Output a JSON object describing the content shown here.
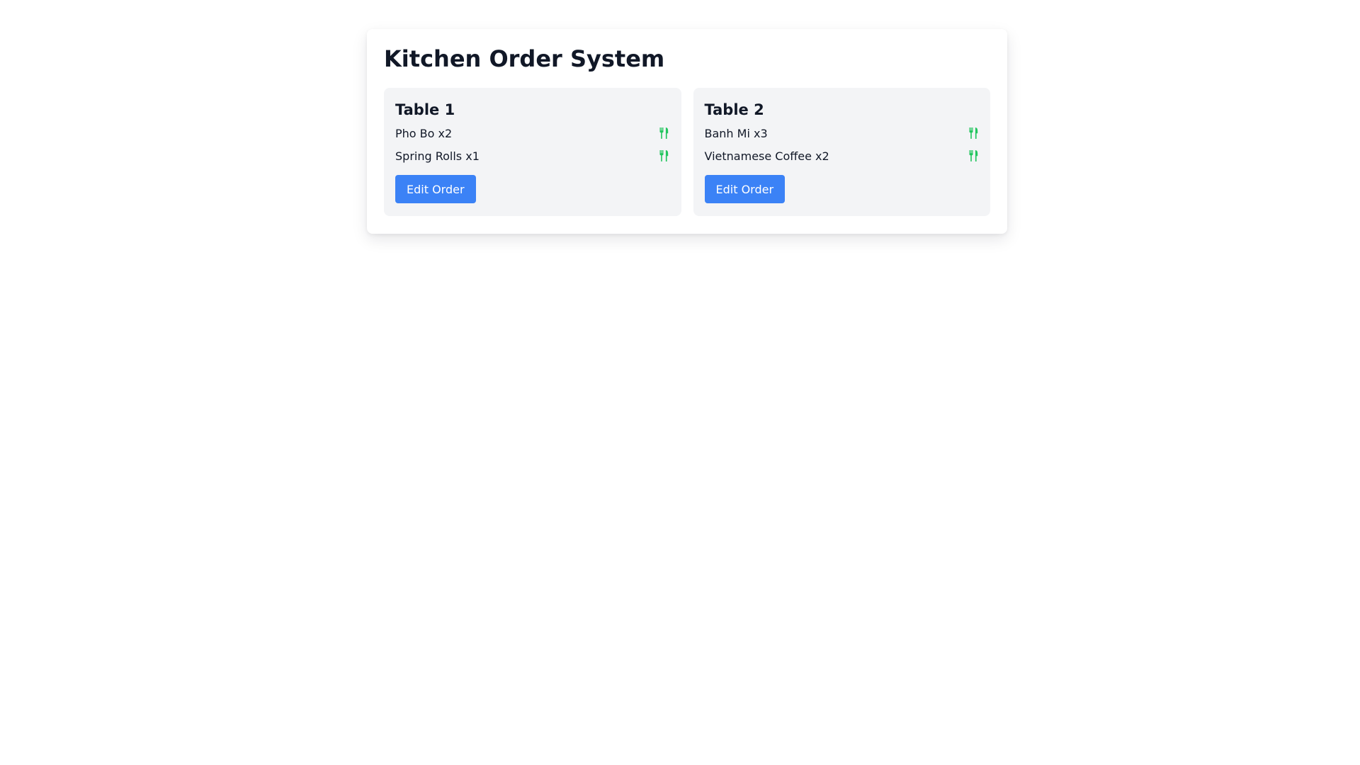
{
  "app": {
    "title": "Kitchen Order System"
  },
  "colors": {
    "accent": "#3b82f6",
    "status_icon": "#22c55e",
    "card_background": "#f3f4f6"
  },
  "tables": [
    {
      "name": "Table 1",
      "items": [
        {
          "label": "Pho Bo x2",
          "icon": "utensils-icon"
        },
        {
          "label": "Spring Rolls x1",
          "icon": "utensils-icon"
        }
      ],
      "edit_label": "Edit Order"
    },
    {
      "name": "Table 2",
      "items": [
        {
          "label": "Banh Mi x3",
          "icon": "utensils-icon"
        },
        {
          "label": "Vietnamese Coffee x2",
          "icon": "utensils-icon"
        }
      ],
      "edit_label": "Edit Order"
    }
  ]
}
